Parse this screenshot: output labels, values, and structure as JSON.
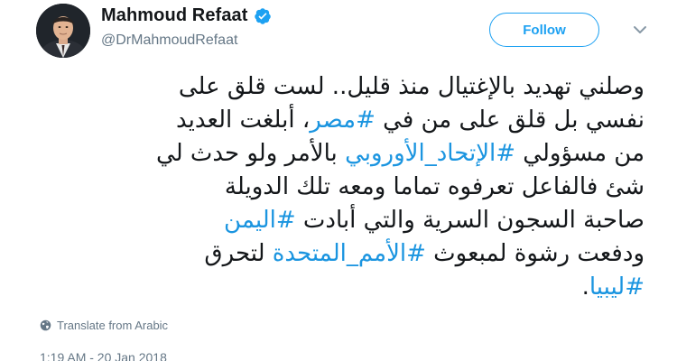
{
  "author": {
    "display_name": "Mahmoud Refaat",
    "handle": "@DrMahmoudRefaat",
    "verified": true
  },
  "actions": {
    "follow_label": "Follow"
  },
  "tweet": {
    "line1": {
      "t0": "وصلني تهديد بالإغتيال منذ قليل.. لست قلق على"
    },
    "line2": {
      "t0": "نفسي بل قلق على من في ",
      "h0": "#مصر",
      "t1": "، أبلغت العديد"
    },
    "line3": {
      "t0": "من مسؤولي ",
      "h0": "#الإتحاد_الأوروبي",
      "t1": " بالأمر ولو حدث لي"
    },
    "line4": {
      "t0": "شئ فالفاعل تعرفوه تماما ومعه تلك الدويلة"
    },
    "line5": {
      "t0": "صاحبة السجون السرية والتي أبادت ",
      "h0": "#اليمن"
    },
    "line6": {
      "t0": "ودفعت رشوة لمبعوث ",
      "h0": "#الأمم_المتحدة",
      "t1": " لتحرق"
    },
    "line7": {
      "h0": "#ليبيا",
      "t0": "."
    }
  },
  "translate": {
    "label": "Translate from Arabic",
    "icon": "globe-icon"
  },
  "meta": {
    "timestamp": "1:19 AM - 20 Jan 2018"
  },
  "colors": {
    "accent": "#1da1f2",
    "hashtag": "#1b95e0",
    "secondary_text": "#657786",
    "primary_text": "#14171a"
  }
}
